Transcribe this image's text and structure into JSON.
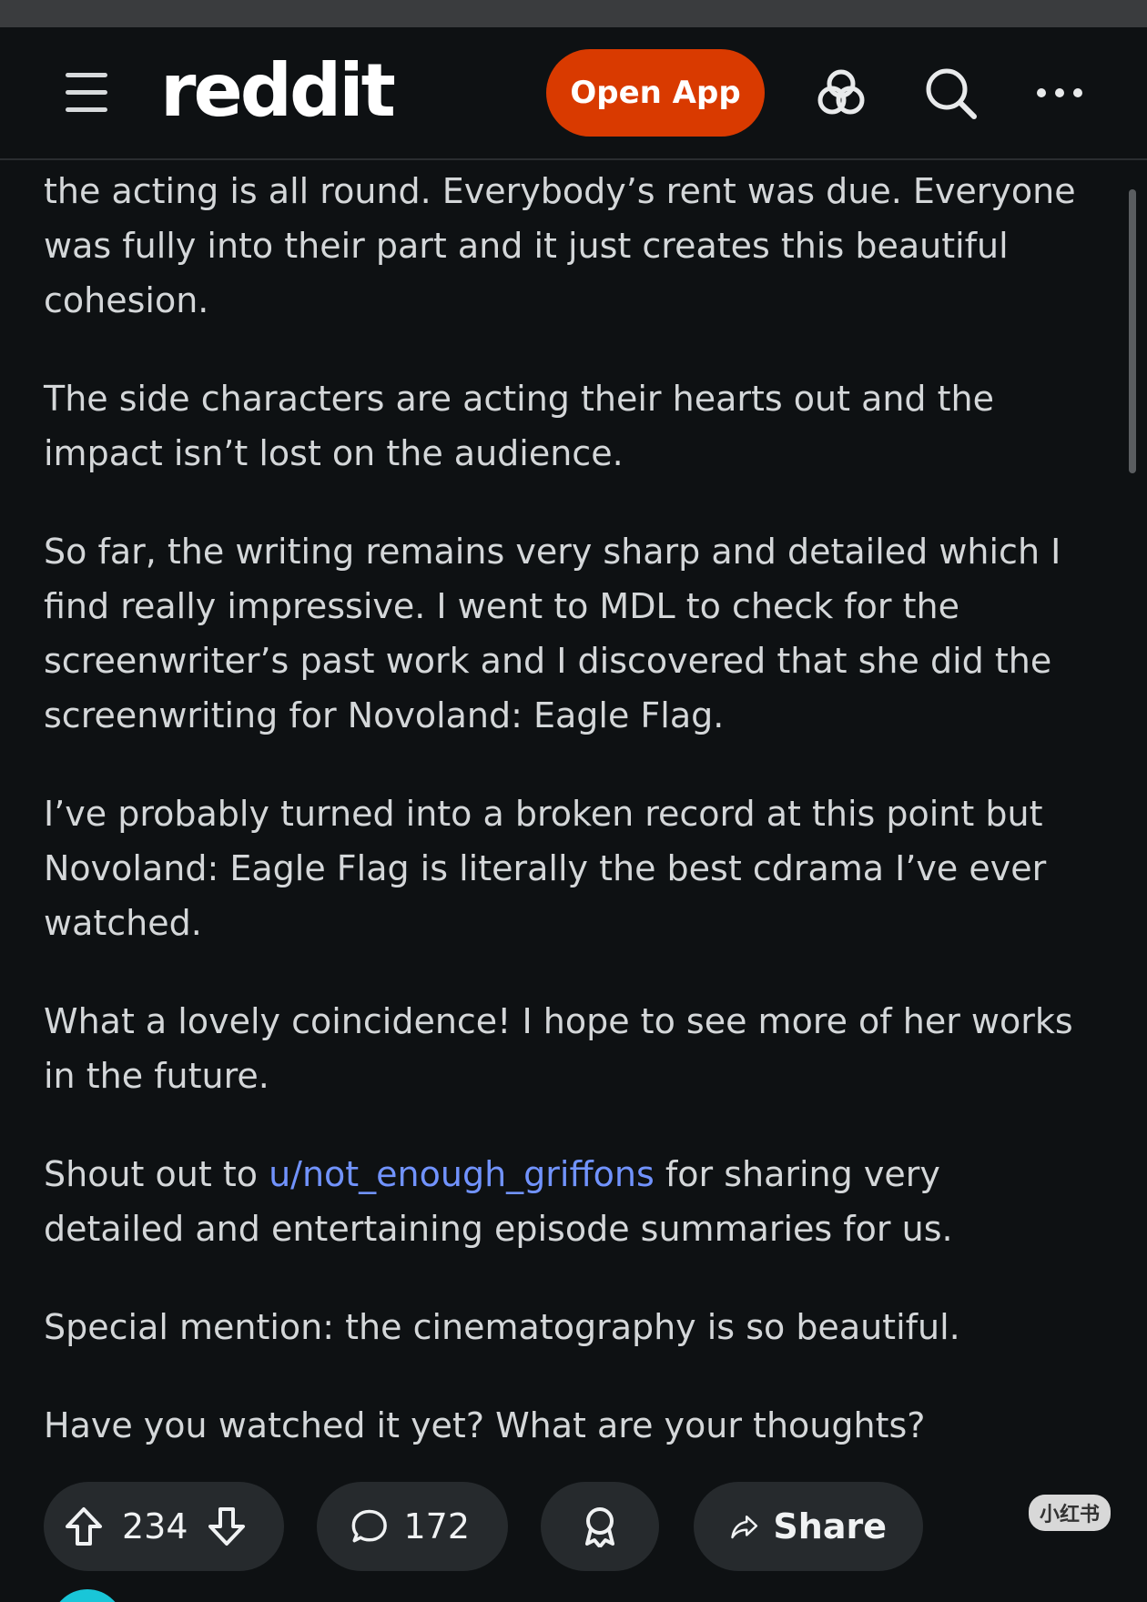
{
  "header": {
    "logo": "reddit",
    "open_app_label": "Open App"
  },
  "post": {
    "paragraphs": [
      "the acting is all round. Everybody’s rent was due. Everyone was fully into their part and it just creates this beautiful cohesion.",
      "The side characters are acting their hearts out and the impact isn’t lost on the audience.",
      "So far, the writing remains very sharp and detailed which I find really impressive. I went to MDL to check for the screenwriter’s past work and I discovered that she did the screenwriting for Novoland: Eagle Flag.",
      "I’ve probably turned into a broken record at this point but Novoland: Eagle Flag is literally the best cdrama I’ve ever watched.",
      "What a lovely coincidence! I hope to see more of her works in the future."
    ],
    "shoutout": {
      "before": "Shout out to ",
      "link": "u/not_enough_griffons",
      "after": " for sharing very detailed and entertaining episode summaries for us."
    },
    "closing_paragraphs": [
      "Special mention: the cinematography is so beautiful.",
      "Have you watched it yet? What are your thoughts?"
    ]
  },
  "actions": {
    "votes": "234",
    "comments": "172",
    "share_label": "Share"
  },
  "watermark": "小红书",
  "colors": {
    "accent": "#d93a00",
    "link": "#7193ff",
    "background": "#0e1113",
    "pill": "#262a2d"
  }
}
